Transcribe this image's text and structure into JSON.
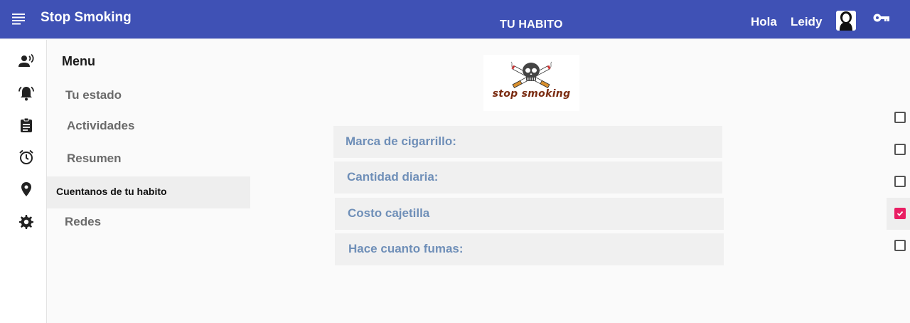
{
  "header": {
    "app_title": "Stop Smoking",
    "page_title": "TU HABITO",
    "greeting": "Hola",
    "user_name": "Leidy",
    "accent_color": "#3f51b5"
  },
  "icon_rail": [
    {
      "icon": "record-voice-icon"
    },
    {
      "icon": "notifications-icon"
    },
    {
      "icon": "assignment-icon"
    },
    {
      "icon": "alarm-icon"
    },
    {
      "icon": "location-pin-icon"
    },
    {
      "icon": "settings-icon"
    }
  ],
  "menu": {
    "title": "Menu",
    "items": [
      {
        "label": "Tu estado"
      },
      {
        "label": "Actividades"
      },
      {
        "label": "Resumen"
      },
      {
        "label": "Cuentanos de tu habito",
        "active": true
      },
      {
        "label": "Redes"
      }
    ]
  },
  "logo": {
    "text": "stop smoking"
  },
  "form": {
    "fields": [
      {
        "placeholder": "Marca de cigarrillo:"
      },
      {
        "placeholder": "Cantidad diaria:"
      },
      {
        "placeholder": "Costo cajetilla"
      },
      {
        "placeholder": "Hace cuanto fumas:"
      }
    ]
  },
  "checkboxes": [
    {
      "checked": false
    },
    {
      "checked": false
    },
    {
      "checked": false
    },
    {
      "checked": true,
      "color": "#e91e63"
    },
    {
      "checked": false
    }
  ]
}
